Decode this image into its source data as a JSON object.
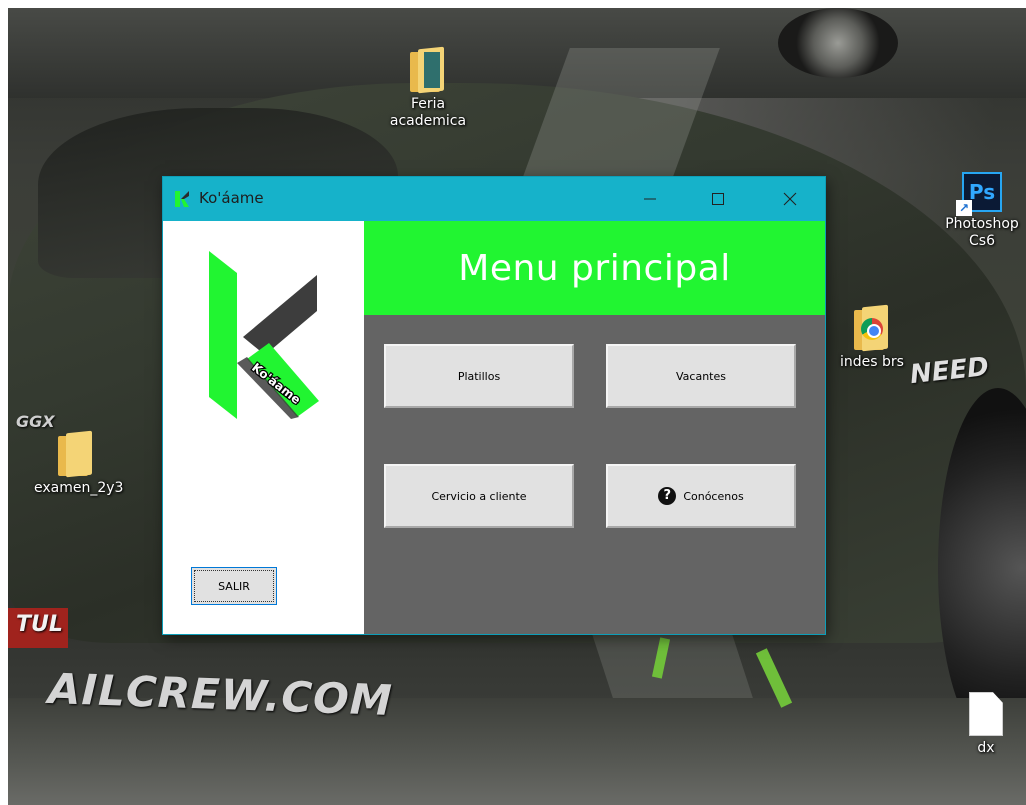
{
  "window": {
    "title": "Ko'áame",
    "header_title": "Menu principal",
    "exit_label": "SALIR",
    "logo_text": "Ko'áame"
  },
  "menu": {
    "platillos": "Platillos",
    "vacantes": "Vacantes",
    "servicio": "Cervicio a cliente",
    "conocenos": "Conócenos",
    "help_glyph": "?"
  },
  "desktop_icons": {
    "feria": "Feria\nacademica",
    "photoshop": "Photoshop\nCs6",
    "indes": "indes brs",
    "examen": "examen_2y3",
    "dx": "dx",
    "ps_letters": "Ps"
  },
  "wallpaper_text": {
    "crew": "AILCREW.COM",
    "tul": "TUL",
    "ggx": "GGX",
    "need": "NEED"
  },
  "colors": {
    "titlebar": "#16b2ca",
    "header": "#21f531",
    "panel": "#646464",
    "logo_green": "#21f531",
    "logo_dark": "#3d3d3d"
  }
}
